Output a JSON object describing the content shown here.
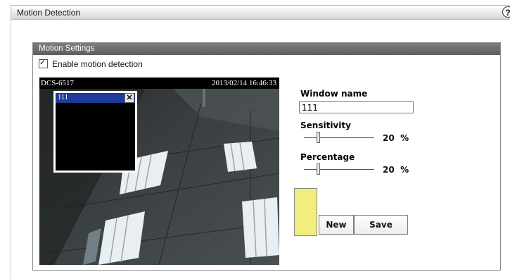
{
  "header": {
    "title": "Motion Detection",
    "help_glyph": "?"
  },
  "settings": {
    "section_title": "Motion Settings",
    "enable_label": "Enable motion detection",
    "enable_checked": true
  },
  "video": {
    "camera_name": "DCS-6517",
    "timestamp": "2013/02/14 16:46:33"
  },
  "detection_window": {
    "name": "111",
    "close_glyph": "✕"
  },
  "controls": {
    "window_name_label": "Window name",
    "window_name_value": "111",
    "sensitivity_label": "Sensitivity",
    "sensitivity_value": "20",
    "sensitivity_unit": "%",
    "percentage_label": "Percentage",
    "percentage_value": "20",
    "percentage_unit": "%",
    "window_color": "#f1ee7e"
  },
  "buttons": {
    "new_label": "New",
    "save_label": "Save"
  },
  "icons": {
    "help": "help-icon",
    "checkbox": "checkmark-icon",
    "close": "close-icon"
  }
}
